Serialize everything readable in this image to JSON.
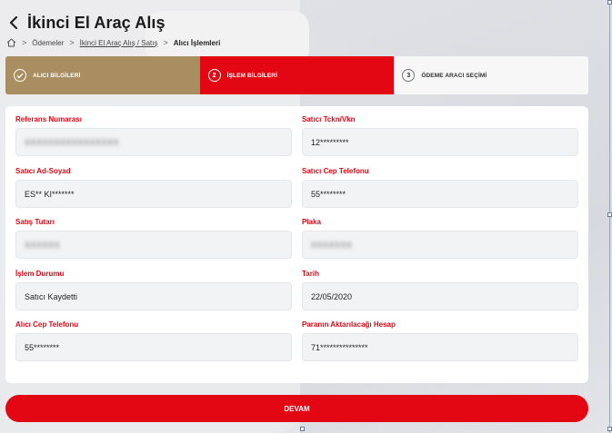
{
  "header": {
    "title": "İkinci El Araç Alış",
    "back_icon": "chevron-left-icon"
  },
  "breadcrumb": {
    "home_icon": "home-icon",
    "items": [
      "Ödemeler",
      "İkinci El Araç Alış / Satış",
      "Alıcı İşlemleri"
    ]
  },
  "stepper": {
    "steps": [
      {
        "number": "",
        "label": "ALICI BİLGİLERİ",
        "state": "done"
      },
      {
        "number": "2",
        "label": "İŞLEM BİLGİLERİ",
        "state": "active"
      },
      {
        "number": "3",
        "label": "ÖDEME ARACI SEÇİMİ",
        "state": "todo"
      }
    ],
    "colors": {
      "done": "#a88e60",
      "active": "#e30613",
      "todo": "#f7f7f8"
    }
  },
  "form": {
    "referans": {
      "label": "Referans Numarası",
      "value": "XXXXXXXXXXXXXXXX"
    },
    "satici_tckn": {
      "label": "Satıcı Tckn/Vkn",
      "value": "12*********"
    },
    "satici_ad": {
      "label": "Satıcı Ad-Soyad",
      "value": "ES** KI*******"
    },
    "satici_tel": {
      "label": "Satıcı Cep Telefonu",
      "value": "55********"
    },
    "satis_tutari": {
      "label": "Satış Tutarı",
      "value": "XXXXXX"
    },
    "plaka": {
      "label": "Plaka",
      "value": "XXXXXXX"
    },
    "islem_durumu": {
      "label": "İşlem Durumu",
      "value": "Satıcı Kaydetti"
    },
    "tarih": {
      "label": "Tarih",
      "value": "22/05/2020"
    },
    "alici_tel": {
      "label": "Alıcı Cep Telefonu",
      "value": "55********"
    },
    "hesap": {
      "label": "Paranın Aktarılacağı Hesap",
      "value": "71***************"
    }
  },
  "actions": {
    "continue_label": "DEVAM",
    "accent": "#e30613"
  }
}
